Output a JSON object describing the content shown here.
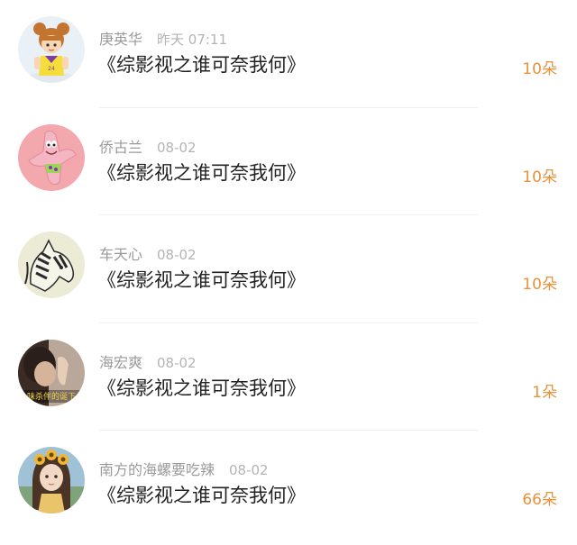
{
  "accent_color": "#e8923c",
  "rows": [
    {
      "username": "庚英华",
      "time": "昨天 07:11",
      "title": "《综影视之谁可奈我何》",
      "gift": "10朵",
      "avatar_icon": "cartoon-girl-basketball-avatar"
    },
    {
      "username": "侨古兰",
      "time": "08-02",
      "title": "《综影视之谁可奈我何》",
      "gift": "10朵",
      "avatar_icon": "patrick-star-avatar"
    },
    {
      "username": "车天心",
      "time": "08-02",
      "title": "《综影视之谁可奈我何》",
      "gift": "10朵",
      "avatar_icon": "zebra-sketch-avatar"
    },
    {
      "username": "海宏爽",
      "time": "08-02",
      "title": "《综影视之谁可奈我何》",
      "gift": "1朵",
      "avatar_icon": "photo-person-avatar",
      "avatar_caption": "味杀伴的诞下"
    },
    {
      "username": "南方的海螺要吃辣",
      "time": "08-02",
      "title": "《综影视之谁可奈我何》",
      "gift": "66朵",
      "avatar_icon": "sunflower-girl-avatar"
    }
  ]
}
